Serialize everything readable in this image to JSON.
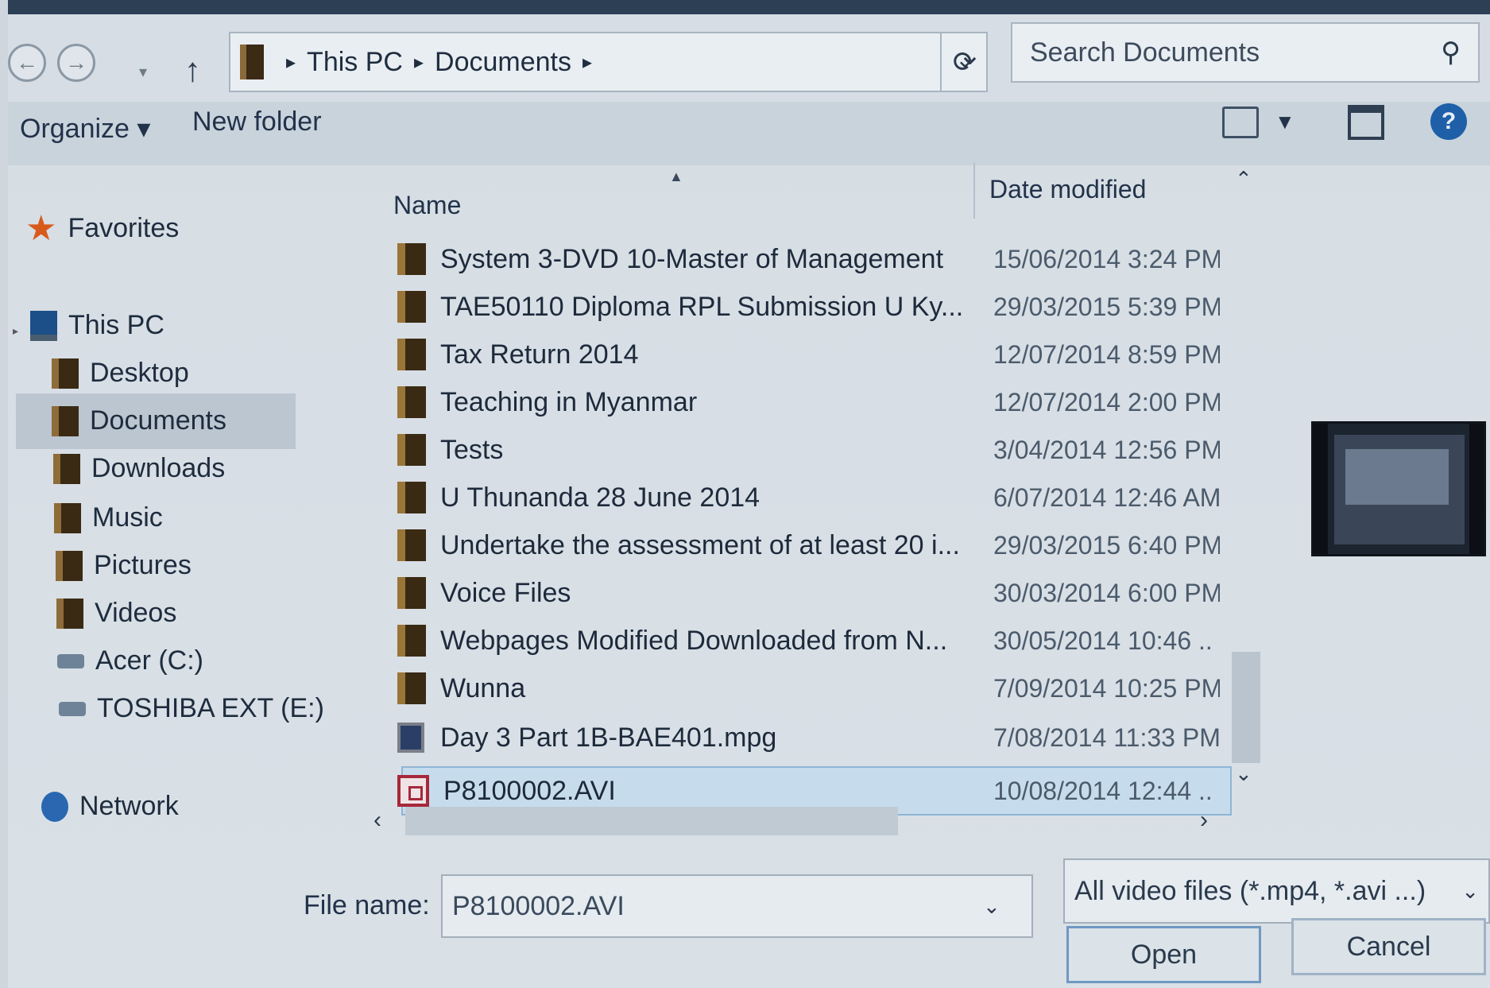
{
  "nav": {
    "back_glyph": "←",
    "forward_glyph": "→",
    "history_glyph": "▾",
    "up_glyph": "↑"
  },
  "address": {
    "crumbs": [
      "This PC",
      "Documents"
    ],
    "dropdown_glyph": "⌄",
    "refresh_glyph": "⟳"
  },
  "search": {
    "placeholder": "Search Documents",
    "icon": "search-icon"
  },
  "toolbar": {
    "organize_label": "Organize ▾",
    "new_folder_label": "New folder",
    "help_glyph": "?"
  },
  "sidebar": {
    "favorites": "Favorites",
    "this_pc": "This PC",
    "desktop": "Desktop",
    "documents": "Documents",
    "downloads": "Downloads",
    "music": "Music",
    "pictures": "Pictures",
    "videos": "Videos",
    "acer": "Acer (C:)",
    "toshiba": "TOSHIBA EXT (E:)",
    "network": "Network"
  },
  "columns": {
    "name": "Name",
    "date": "Date modified"
  },
  "files": [
    {
      "name": "System 3-DVD 10-Master of Management",
      "date": "15/06/2014 3:24 PM",
      "type": "folder"
    },
    {
      "name": "TAE50110 Diploma RPL Submission U Ky...",
      "date": "29/03/2015 5:39 PM",
      "type": "folder"
    },
    {
      "name": "Tax Return 2014",
      "date": "12/07/2014 8:59 PM",
      "type": "folder"
    },
    {
      "name": "Teaching in Myanmar",
      "date": "12/07/2014 2:00 PM",
      "type": "folder"
    },
    {
      "name": "Tests",
      "date": "3/04/2014 12:56 PM",
      "type": "folder"
    },
    {
      "name": "U Thunanda 28 June 2014",
      "date": "6/07/2014 12:46 AM",
      "type": "folder"
    },
    {
      "name": "Undertake the assessment of at least 20 i...",
      "date": "29/03/2015 6:40 PM",
      "type": "folder"
    },
    {
      "name": "Voice Files",
      "date": "30/03/2014 6:00 PM",
      "type": "folder"
    },
    {
      "name": "Webpages Modified Downloaded from N...",
      "date": "30/05/2014 10:46 ..",
      "type": "folder"
    },
    {
      "name": "Wunna",
      "date": "7/09/2014 10:25 PM",
      "type": "folder"
    },
    {
      "name": "Day 3 Part 1B-BAE401.mpg",
      "date": "7/08/2014 11:33 PM",
      "type": "video"
    },
    {
      "name": "P8100002.AVI",
      "date": "10/08/2014 12:44 ..",
      "type": "avi",
      "selected": true
    }
  ],
  "bottom": {
    "file_name_label": "File name:",
    "file_name_value": "P8100002.AVI",
    "file_type": "All video files (*.mp4, *.avi ...)",
    "open_label": "Open",
    "cancel_label": "Cancel"
  },
  "colors": {
    "selection": "#c6dcec",
    "accent": "#1e5fa8",
    "favorites_star": "#d85a1a"
  }
}
